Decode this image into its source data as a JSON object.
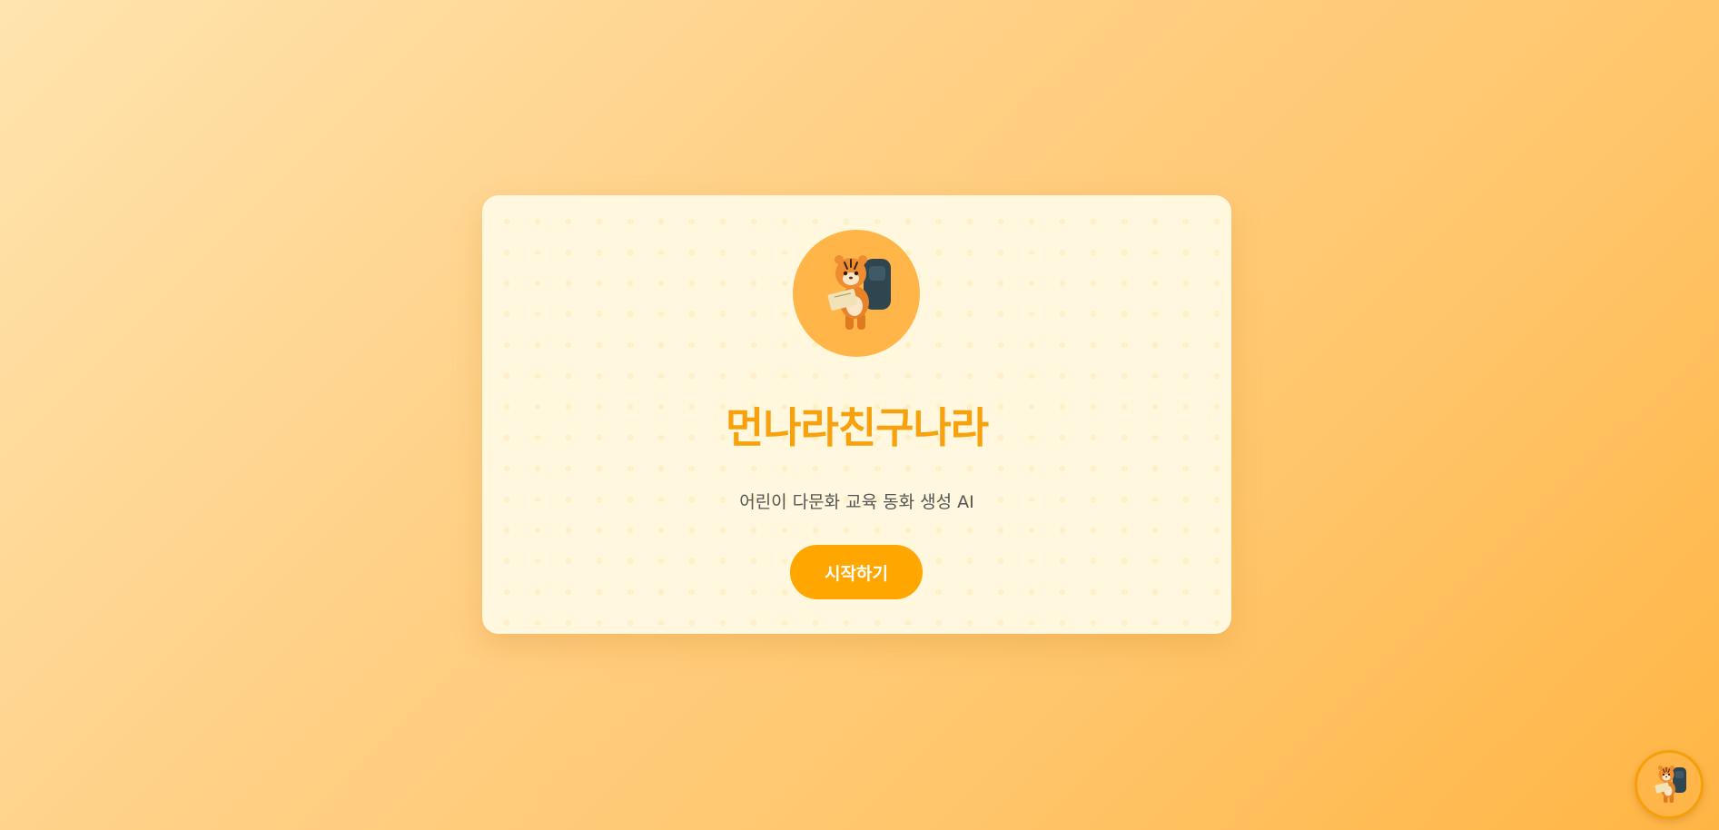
{
  "app": {
    "title": "먼나라친구나라",
    "subtitle": "어린이 다문화 교육 동화 생성 AI"
  },
  "actions": {
    "start_label": "시작하기"
  },
  "mascot": {
    "icon": "tiger-explorer-icon",
    "background_color": "#ffb547"
  },
  "colors": {
    "accent": "#ffa600",
    "title": "#f7a20d",
    "card_background": "#fff7de"
  }
}
